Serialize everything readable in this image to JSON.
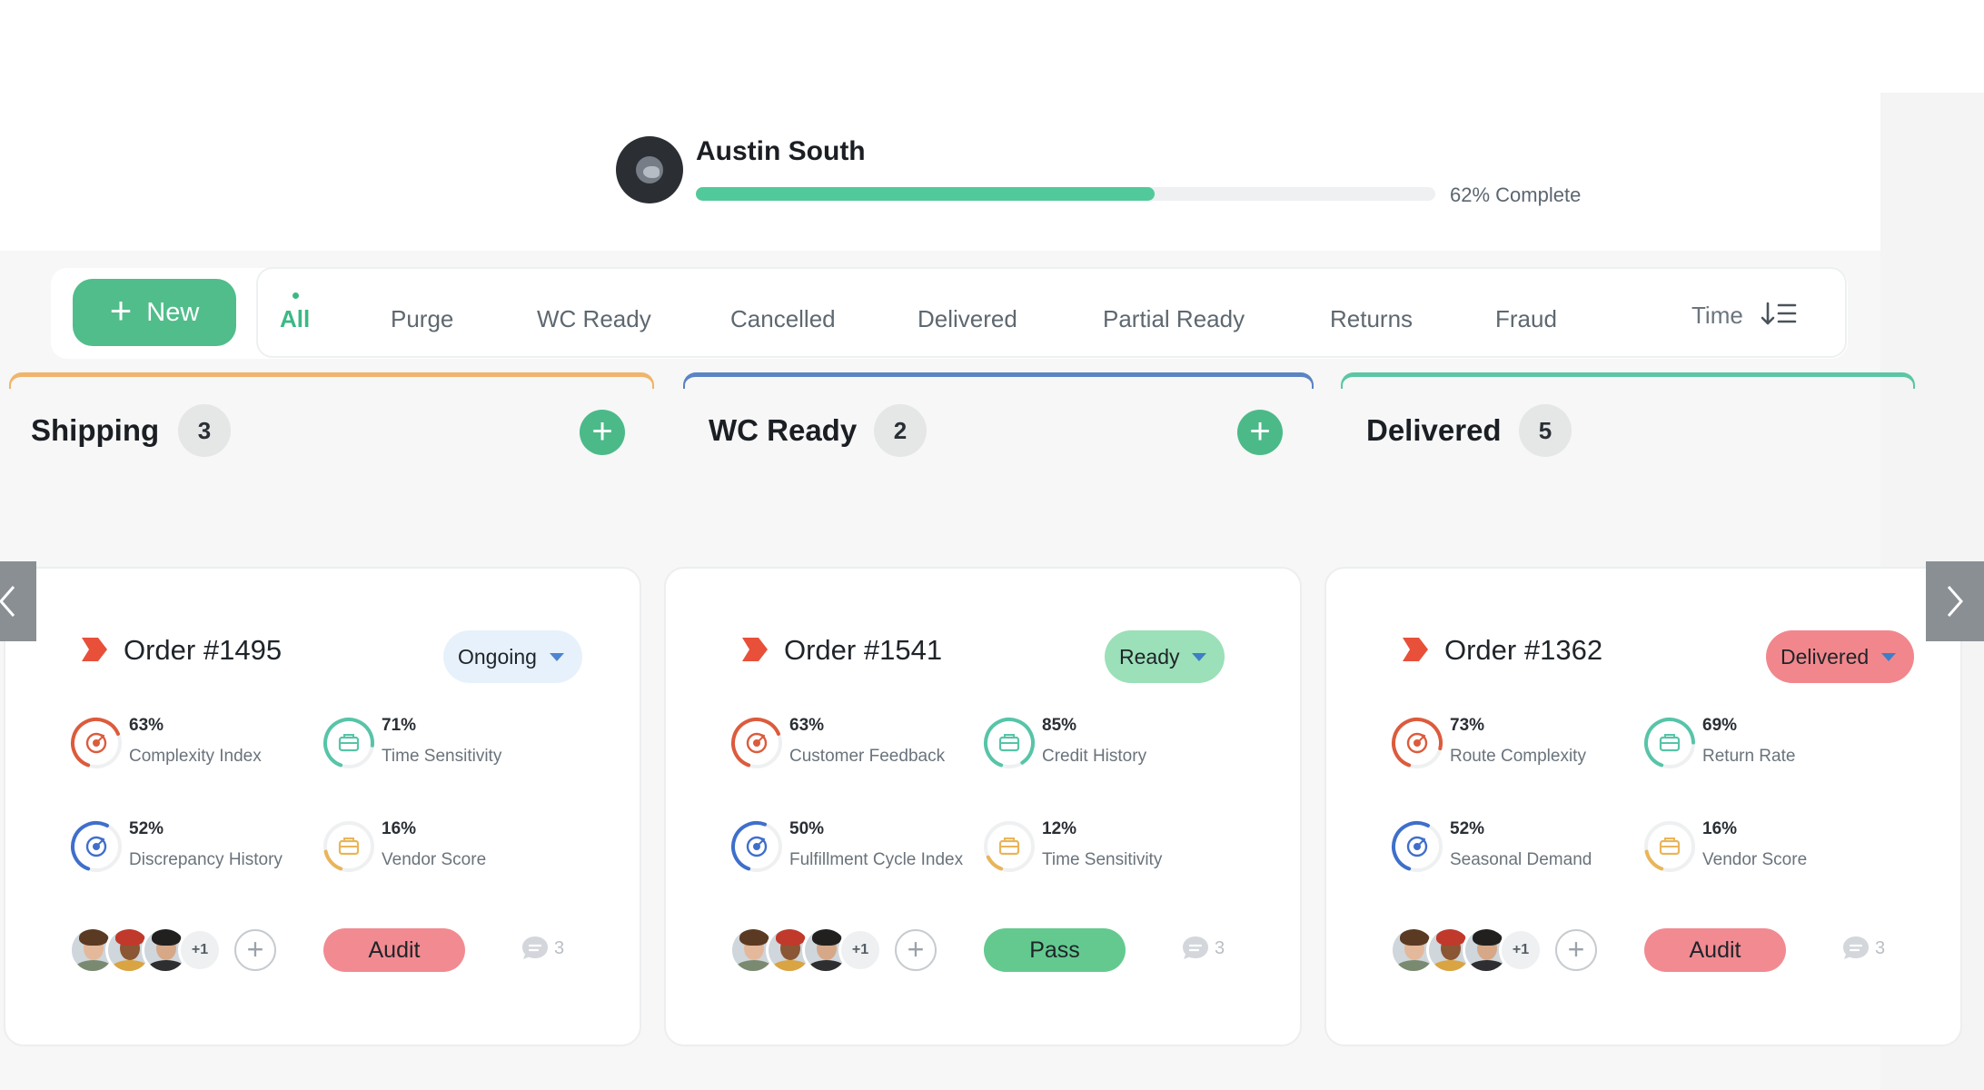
{
  "header": {
    "user_name": "Austin South",
    "progress_percent": 62,
    "progress_text": "62% Complete"
  },
  "toolbar": {
    "new_label": "New",
    "tabs": [
      {
        "label": "All",
        "active": true
      },
      {
        "label": "Purge",
        "active": false
      },
      {
        "label": "WC Ready",
        "active": false
      },
      {
        "label": "Cancelled",
        "active": false
      },
      {
        "label": "Delivered",
        "active": false
      },
      {
        "label": "Partial Ready",
        "active": false
      },
      {
        "label": "Returns",
        "active": false
      },
      {
        "label": "Fraud",
        "active": false
      }
    ],
    "sort_label": "Time",
    "sort_icon": "sort-ascending-icon"
  },
  "columns": [
    {
      "title": "Shipping",
      "count": "3",
      "accent": "#f0b46c",
      "has_add": true
    },
    {
      "title": "WC Ready",
      "count": "2",
      "accent": "#5b84c4",
      "has_add": true
    },
    {
      "title": "Delivered",
      "count": "5",
      "accent": "#5cc6a4",
      "has_add": false
    }
  ],
  "cards": [
    {
      "order": "Order #1495",
      "status": "Ongoing",
      "status_bg": "#e7f1fb",
      "status_caret": "#4a86d0",
      "metrics": [
        {
          "pct": "63%",
          "label": "Complexity Index",
          "value": 63,
          "color": "#dc5b3c",
          "icon": "target-icon"
        },
        {
          "pct": "71%",
          "label": "Time Sensitivity",
          "value": 71,
          "color": "#57c4a8",
          "icon": "briefcase-icon"
        },
        {
          "pct": "52%",
          "label": "Discrepancy History",
          "value": 52,
          "color": "#3f6fcb",
          "icon": "target-icon"
        },
        {
          "pct": "16%",
          "label": "Vendor Score",
          "value": 16,
          "color": "#e9b55a",
          "icon": "briefcase-icon"
        }
      ],
      "extra_members": "+1",
      "action": "Audit",
      "action_bg": "#f18b91",
      "comments": "3"
    },
    {
      "order": "Order #1541",
      "status": "Ready",
      "status_bg": "#9be0b8",
      "status_caret": "#3c7fc8",
      "metrics": [
        {
          "pct": "63%",
          "label": "Customer Feedback",
          "value": 63,
          "color": "#dc5b3c",
          "icon": "target-icon"
        },
        {
          "pct": "85%",
          "label": "Credit History",
          "value": 85,
          "color": "#57c4a8",
          "icon": "briefcase-icon"
        },
        {
          "pct": "50%",
          "label": "Fulfillment Cycle Index",
          "value": 50,
          "color": "#3f6fcb",
          "icon": "target-icon"
        },
        {
          "pct": "12%",
          "label": "Time Sensitivity",
          "value": 12,
          "color": "#e9b55a",
          "icon": "briefcase-icon"
        }
      ],
      "extra_members": "+1",
      "action": "Pass",
      "action_bg": "#64c98f",
      "comments": "3"
    },
    {
      "order": "Order #1362",
      "status": "Delivered",
      "status_bg": "#f1878c",
      "status_caret": "#3c7fc8",
      "metrics": [
        {
          "pct": "73%",
          "label": "Route Complexity",
          "value": 73,
          "color": "#dc5b3c",
          "icon": "target-icon"
        },
        {
          "pct": "69%",
          "label": "Return Rate",
          "value": 69,
          "color": "#57c4a8",
          "icon": "briefcase-icon"
        },
        {
          "pct": "52%",
          "label": "Seasonal Demand",
          "value": 52,
          "color": "#3f6fcb",
          "icon": "target-icon"
        },
        {
          "pct": "16%",
          "label": "Vendor Score",
          "value": 16,
          "color": "#e9b55a",
          "icon": "briefcase-icon"
        }
      ],
      "extra_members": "+1",
      "action": "Audit",
      "action_bg": "#f18b91",
      "comments": "3"
    }
  ],
  "colors": {
    "accent_green": "#50bd8b",
    "progress_fill": "#52c99a",
    "order_icon": "#e8503a"
  }
}
